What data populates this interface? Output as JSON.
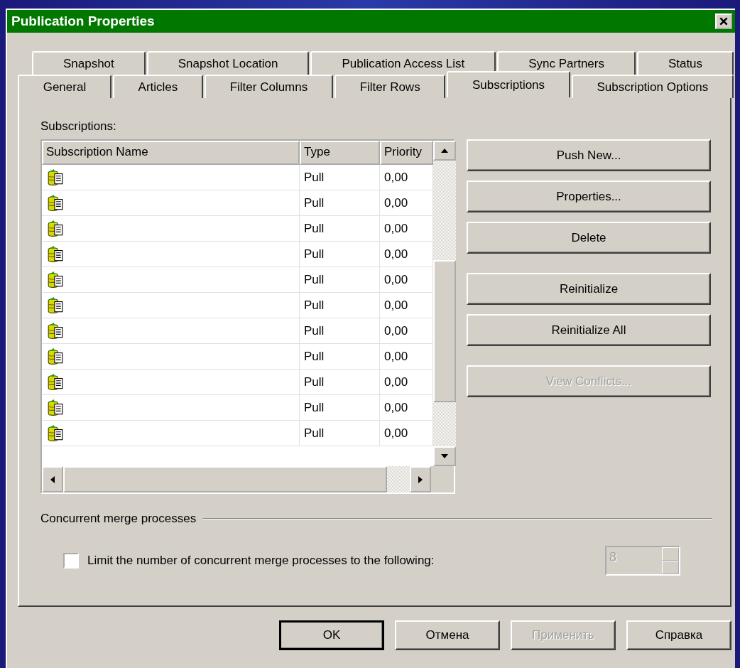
{
  "window": {
    "title": "Publication Properties"
  },
  "tab_rows": [
    [
      {
        "label": "Snapshot",
        "selected": false
      },
      {
        "label": "Snapshot Location",
        "selected": false
      },
      {
        "label": "Publication Access List",
        "selected": false
      },
      {
        "label": "Sync Partners",
        "selected": false
      },
      {
        "label": "Status",
        "selected": false
      }
    ],
    [
      {
        "label": "General",
        "selected": false
      },
      {
        "label": "Articles",
        "selected": false
      },
      {
        "label": "Filter Columns",
        "selected": false
      },
      {
        "label": "Filter Rows",
        "selected": false
      },
      {
        "label": "Subscriptions",
        "selected": true
      },
      {
        "label": "Subscription Options",
        "selected": false
      }
    ]
  ],
  "list_label": "Subscriptions:",
  "list": {
    "columns": [
      "Subscription Name",
      "Type",
      "Priority"
    ],
    "rows": [
      {
        "type": "Pull",
        "priority": "0,00"
      },
      {
        "type": "Pull",
        "priority": "0,00"
      },
      {
        "type": "Pull",
        "priority": "0,00"
      },
      {
        "type": "Pull",
        "priority": "0,00"
      },
      {
        "type": "Pull",
        "priority": "0,00"
      },
      {
        "type": "Pull",
        "priority": "0,00"
      },
      {
        "type": "Pull",
        "priority": "0,00"
      },
      {
        "type": "Pull",
        "priority": "0,00"
      },
      {
        "type": "Pull",
        "priority": "0,00"
      },
      {
        "type": "Pull",
        "priority": "0,00"
      },
      {
        "type": "Pull",
        "priority": "0,00"
      }
    ]
  },
  "action_groups": [
    [
      {
        "label": "Push New...",
        "disabled": false
      },
      {
        "label": "Properties...",
        "disabled": false
      },
      {
        "label": "Delete",
        "disabled": false
      }
    ],
    [
      {
        "label": "Reinitialize",
        "disabled": false
      },
      {
        "label": "Reinitialize All",
        "disabled": false
      }
    ],
    [
      {
        "label": "View Conflicts...",
        "disabled": true
      }
    ]
  ],
  "group": {
    "title": "Concurrent merge processes",
    "checkbox": {
      "label": "Limit the number of concurrent merge processes to the following:",
      "checked": false
    },
    "spin": {
      "value": "8",
      "disabled": true
    }
  },
  "footer": [
    {
      "label": "OK",
      "disabled": false,
      "default": true
    },
    {
      "label": "Отмена",
      "disabled": false,
      "default": false
    },
    {
      "label": "Применить",
      "disabled": true,
      "default": false
    },
    {
      "label": "Справка",
      "disabled": false,
      "default": false
    }
  ]
}
